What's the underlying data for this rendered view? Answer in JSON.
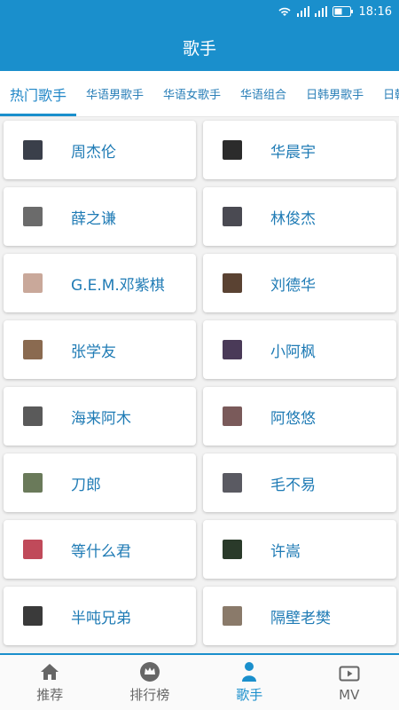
{
  "status_bar": {
    "time": "18:16",
    "icons": [
      "wifi-icon",
      "signal-icon",
      "signal-icon",
      "battery-icon"
    ]
  },
  "app_bar": {
    "title": "歌手"
  },
  "tabs": [
    {
      "label": "热门歌手",
      "active": true
    },
    {
      "label": "华语男歌手",
      "active": false
    },
    {
      "label": "华语女歌手",
      "active": false
    },
    {
      "label": "华语组合",
      "active": false
    },
    {
      "label": "日韩男歌手",
      "active": false
    },
    {
      "label": "日韩",
      "active": false
    }
  ],
  "singers": [
    {
      "name": "周杰伦",
      "avatar_color": "#3a3f4a"
    },
    {
      "name": "华晨宇",
      "avatar_color": "#2b2b2b"
    },
    {
      "name": "薛之谦",
      "avatar_color": "#6b6b6b"
    },
    {
      "name": "林俊杰",
      "avatar_color": "#4a4a52"
    },
    {
      "name": "G.E.M.邓紫棋",
      "avatar_color": "#c9a89a"
    },
    {
      "name": "刘德华",
      "avatar_color": "#5a4232"
    },
    {
      "name": "张学友",
      "avatar_color": "#8a6a50"
    },
    {
      "name": "小阿枫",
      "avatar_color": "#4a3a58"
    },
    {
      "name": "海来阿木",
      "avatar_color": "#5a5a5a"
    },
    {
      "name": "阿悠悠",
      "avatar_color": "#7a5a5a"
    },
    {
      "name": "刀郎",
      "avatar_color": "#6a7a5a"
    },
    {
      "name": "毛不易",
      "avatar_color": "#5a5a62"
    },
    {
      "name": "等什么君",
      "avatar_color": "#c04a5a"
    },
    {
      "name": "许嵩",
      "avatar_color": "#2a3a2a"
    },
    {
      "name": "半吨兄弟",
      "avatar_color": "#3a3a3a"
    },
    {
      "name": "隔壁老樊",
      "avatar_color": "#8a7a6a"
    }
  ],
  "bottom_nav": [
    {
      "label": "推荐",
      "icon": "home-icon",
      "active": false
    },
    {
      "label": "排行榜",
      "icon": "crown-icon",
      "active": false
    },
    {
      "label": "歌手",
      "icon": "person-icon",
      "active": true
    },
    {
      "label": "MV",
      "icon": "video-icon",
      "active": false
    }
  ],
  "colors": {
    "primary": "#1a8fcc",
    "text_link": "#1f7bb5"
  }
}
